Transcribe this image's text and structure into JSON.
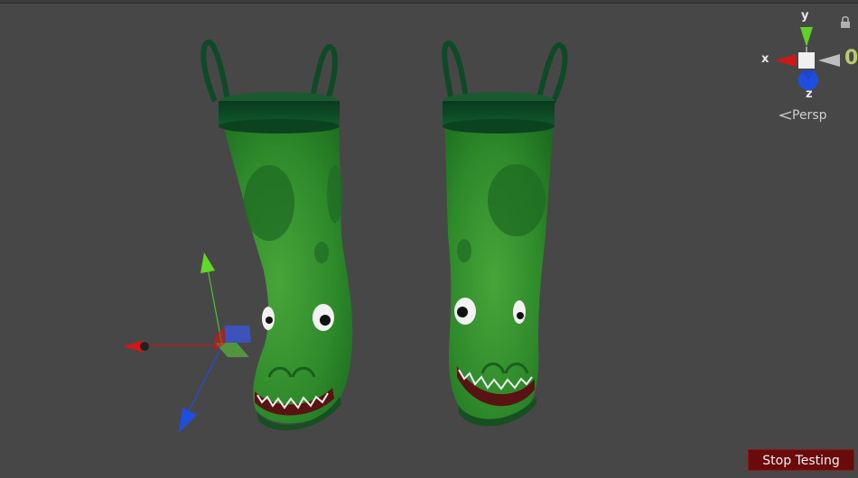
{
  "gizmo": {
    "axis_x": "x",
    "axis_y": "y",
    "axis_z": "z",
    "axis_x_color": "#d01818",
    "axis_y_color": "#5fd02a",
    "axis_z_color": "#1f4de0",
    "projection_label": "Persp",
    "partial_digit": "0",
    "lock_icon": "lock-icon"
  },
  "scene": {
    "object_icons": [
      "left-rain-boot",
      "right-rain-boot",
      "transform-gizmo"
    ],
    "boot_color": "#2f8a2a",
    "rim_color": "#0f4a26"
  },
  "controls": {
    "stop_testing_label": "Stop Testing",
    "stop_testing_color": "#6b0a0a"
  }
}
